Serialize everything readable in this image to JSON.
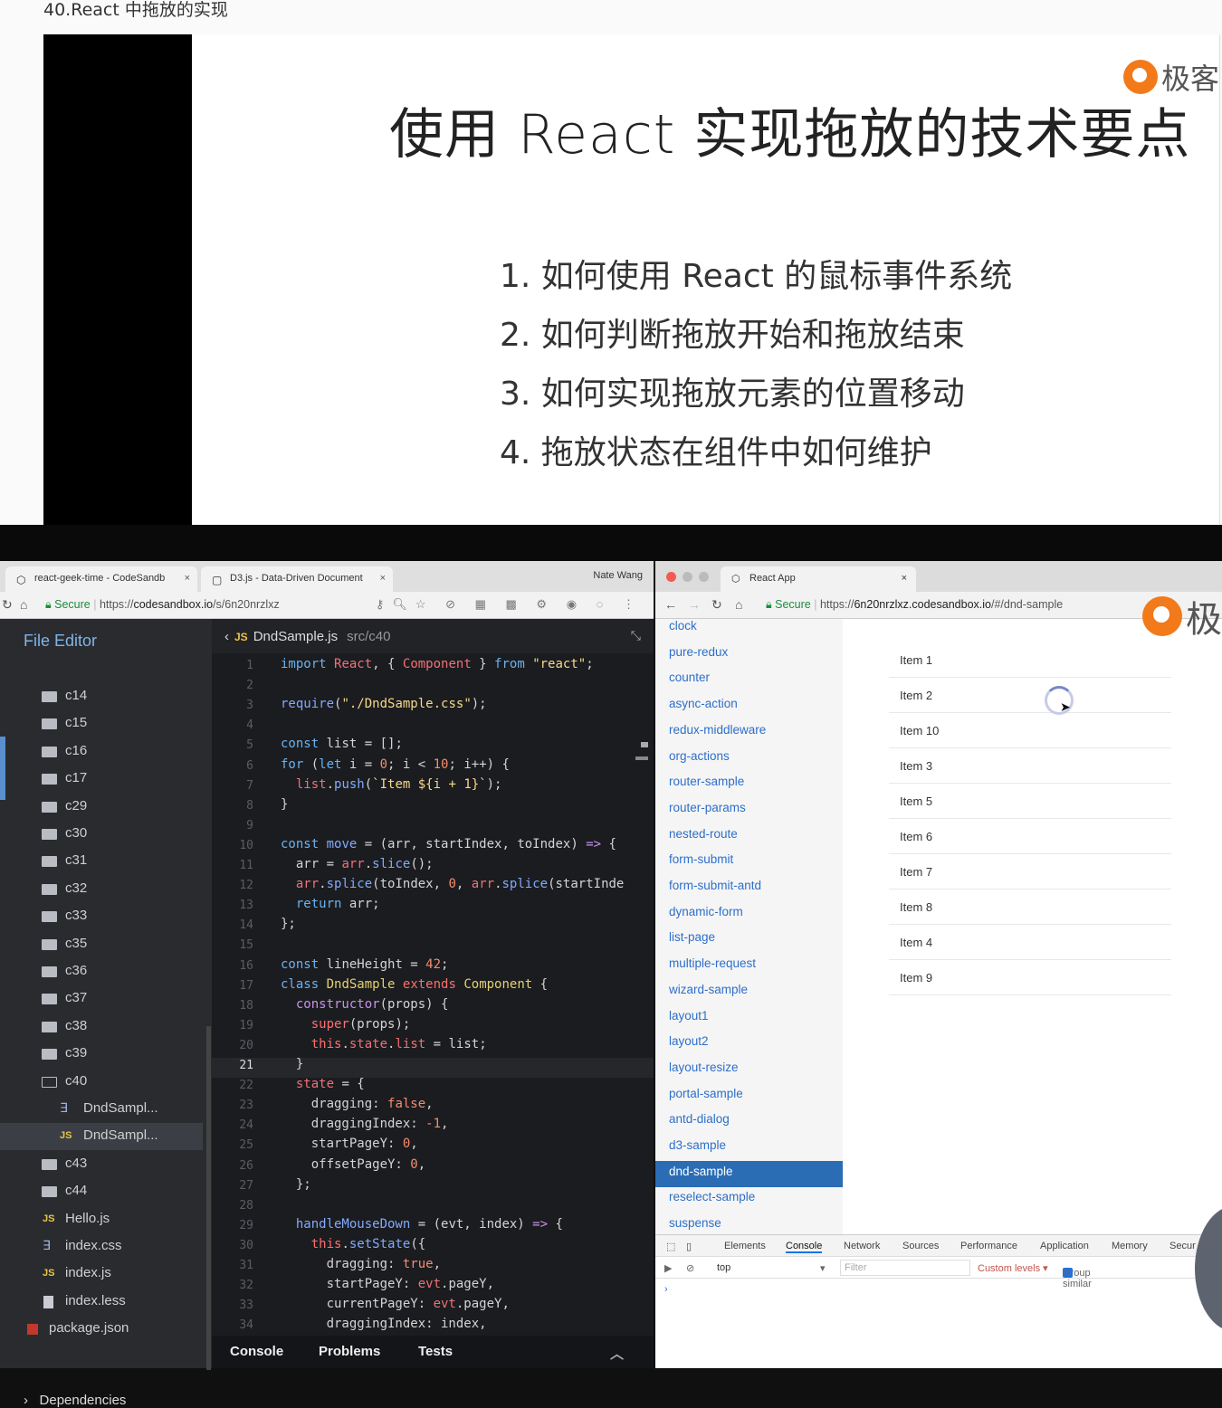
{
  "page": {
    "title": "40.React 中拖放的实现"
  },
  "slide": {
    "logo_text": "极客",
    "heading": "使用 React 实现拖放的技术要点",
    "points": [
      "1. 如何使用 React 的鼠标事件系统",
      "2. 如何判断拖放开始和拖放结束",
      "3. 如何实现拖放元素的位置移动",
      "4. 拖放状态在组件中如何维护"
    ]
  },
  "editor_browser": {
    "tabs": [
      {
        "label": "react-geek-time - CodeSandb",
        "close": "×"
      },
      {
        "label": "D3.js - Data-Driven Document",
        "close": "×"
      }
    ],
    "profile": "Nate Wang",
    "address": {
      "secure": "Secure",
      "scheme": "https://",
      "domain": "codesandbox.io",
      "path": "/s/6n20nrzlxz"
    },
    "sidebar": {
      "title": "File Editor",
      "items": [
        {
          "label": "c14",
          "type": "folder"
        },
        {
          "label": "c15",
          "type": "folder"
        },
        {
          "label": "c16",
          "type": "folder"
        },
        {
          "label": "c17",
          "type": "folder"
        },
        {
          "label": "c29",
          "type": "folder"
        },
        {
          "label": "c30",
          "type": "folder"
        },
        {
          "label": "c31",
          "type": "folder"
        },
        {
          "label": "c32",
          "type": "folder"
        },
        {
          "label": "c33",
          "type": "folder"
        },
        {
          "label": "c35",
          "type": "folder"
        },
        {
          "label": "c36",
          "type": "folder"
        },
        {
          "label": "c37",
          "type": "folder"
        },
        {
          "label": "c38",
          "type": "folder"
        },
        {
          "label": "c39",
          "type": "folder"
        },
        {
          "label": "c40",
          "type": "folder-open"
        },
        {
          "label": "DndSampl...",
          "type": "css"
        },
        {
          "label": "DndSampl...",
          "type": "js",
          "active": true
        },
        {
          "label": "c43",
          "type": "folder"
        },
        {
          "label": "c44",
          "type": "folder"
        },
        {
          "label": "Hello.js",
          "type": "js"
        },
        {
          "label": "index.css",
          "type": "css"
        },
        {
          "label": "index.js",
          "type": "js"
        },
        {
          "label": "index.less",
          "type": "doc"
        },
        {
          "label": "package.json",
          "type": "pkg"
        }
      ],
      "dependencies": "Dependencies",
      "js_badge": "JS"
    },
    "code": {
      "filename": "DndSample.js",
      "path": "src/c40",
      "badge": "JS",
      "current_line": 21,
      "footer_tabs": [
        "Console",
        "Problems",
        "Tests"
      ]
    }
  },
  "app_browser": {
    "tab": {
      "label": "React App",
      "close": "×"
    },
    "address": {
      "secure": "Secure",
      "scheme": "https://",
      "domain": "6n20nrzlxz.codesandbox.io",
      "path": "/#/dnd-sample"
    },
    "logo_text": "极",
    "nav": [
      "clock",
      "pure-redux",
      "counter",
      "async-action",
      "redux-middleware",
      "org-actions",
      "router-sample",
      "router-params",
      "nested-route",
      "form-submit",
      "form-submit-antd",
      "dynamic-form",
      "list-page",
      "multiple-request",
      "wizard-sample",
      "layout1",
      "layout2",
      "layout-resize",
      "portal-sample",
      "antd-dialog",
      "d3-sample",
      "dnd-sample",
      "reselect-sample",
      "suspense"
    ],
    "selected_nav": "dnd-sample",
    "list": [
      "Item 1",
      "Item 2",
      "Item 10",
      "Item 3",
      "Item 5",
      "Item 6",
      "Item 7",
      "Item 8",
      "Item 4",
      "Item 9"
    ],
    "devtools": {
      "tabs": [
        "Elements",
        "Console",
        "Network",
        "Sources",
        "Performance",
        "Application",
        "Memory",
        "Secur"
      ],
      "active_tab": "Console",
      "context": "top",
      "filter_placeholder": "Filter",
      "levels": "Custom levels ▾",
      "group_similar": "Group similar",
      "prompt": "›"
    }
  }
}
